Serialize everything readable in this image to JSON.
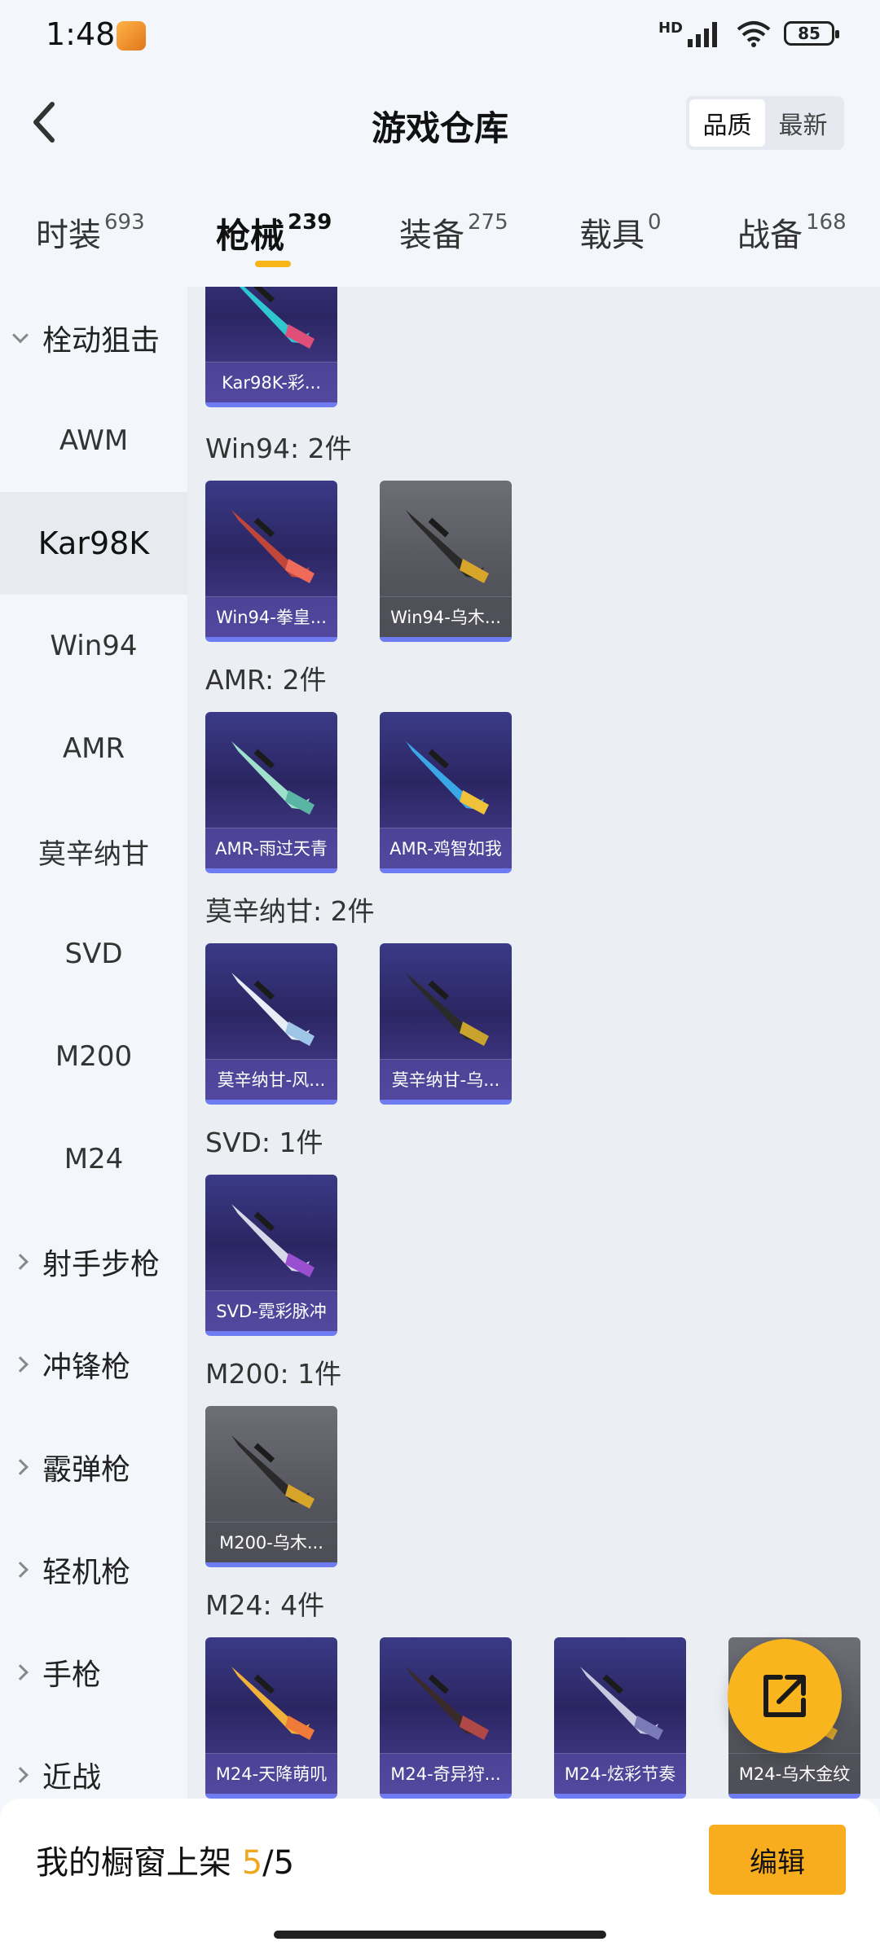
{
  "status": {
    "time": "1:48",
    "network": "HD",
    "battery": "85"
  },
  "header": {
    "title": "游戏仓库",
    "sort": [
      "品质",
      "最新"
    ],
    "sort_active": 0
  },
  "tabs": [
    {
      "label": "时装",
      "count": "693"
    },
    {
      "label": "枪械",
      "count": "239"
    },
    {
      "label": "装备",
      "count": "275"
    },
    {
      "label": "载具",
      "count": "0"
    },
    {
      "label": "战备",
      "count": "168"
    }
  ],
  "sidebar": {
    "group_open": "栓动狙击",
    "items": [
      "AWM",
      "Kar98K",
      "Win94",
      "AMR",
      "莫辛纳甘",
      "SVD",
      "M200",
      "M24"
    ],
    "active_item": "Kar98K",
    "groups": [
      "射手步枪",
      "冲锋枪",
      "霰弹枪",
      "轻机枪",
      "手枪",
      "近战"
    ]
  },
  "content": {
    "top_card": {
      "name": "Kar98K-彩...",
      "gun": "#2fc7d0",
      "accent": "#e04f7a"
    },
    "sections": [
      {
        "title": "Win94: 2件",
        "cards": [
          {
            "name": "Win94-拳皇...",
            "grey": false,
            "gun": "#c0463a",
            "accent": "#f06a5a"
          },
          {
            "name": "Win94-乌木...",
            "grey": true,
            "gun": "#2a2a2a",
            "accent": "#d8a52b"
          }
        ]
      },
      {
        "title": "AMR: 2件",
        "cards": [
          {
            "name": "AMR-雨过天青",
            "grey": false,
            "gun": "#9fe0cc",
            "accent": "#5bb5a5"
          },
          {
            "name": "AMR-鸡智如我",
            "grey": false,
            "gun": "#3aa8e6",
            "accent": "#f0c23a"
          }
        ]
      },
      {
        "title": "莫辛纳甘: 2件",
        "cards": [
          {
            "name": "莫辛纳甘-风...",
            "grey": false,
            "gun": "#e8eef5",
            "accent": "#9fc6e6"
          },
          {
            "name": "莫辛纳甘-乌...",
            "grey": false,
            "gun": "#2a2a2a",
            "accent": "#c8a32e"
          }
        ]
      },
      {
        "title": "SVD: 1件",
        "cards": [
          {
            "name": "SVD-霓彩脉冲",
            "grey": false,
            "gun": "#d8d8e8",
            "accent": "#9a4fd0"
          }
        ]
      },
      {
        "title": "M200: 1件",
        "cards": [
          {
            "name": "M200-乌木...",
            "grey": true,
            "gun": "#2a2a2a",
            "accent": "#d8a52b"
          }
        ]
      },
      {
        "title": "M24: 4件",
        "cards": [
          {
            "name": "M24-天降萌叽",
            "grey": false,
            "gun": "#f0b23a",
            "accent": "#f07a3a"
          },
          {
            "name": "M24-奇异狩...",
            "grey": false,
            "gun": "#3a2a2a",
            "accent": "#b04848"
          },
          {
            "name": "M24-炫彩节奏",
            "grey": false,
            "gun": "#c8c8e0",
            "accent": "#7a7ab8"
          },
          {
            "name": "M24-乌木金纹",
            "grey": true,
            "gun": "#2a2a2a",
            "accent": "#d8a52b"
          }
        ]
      }
    ]
  },
  "bottom": {
    "prefix": "我的橱窗上架 ",
    "count": "5",
    "total": "/5",
    "edit_label": "编辑"
  },
  "colors": {
    "accent": "#f7ad1d",
    "card_border": "#6f7bf0"
  }
}
